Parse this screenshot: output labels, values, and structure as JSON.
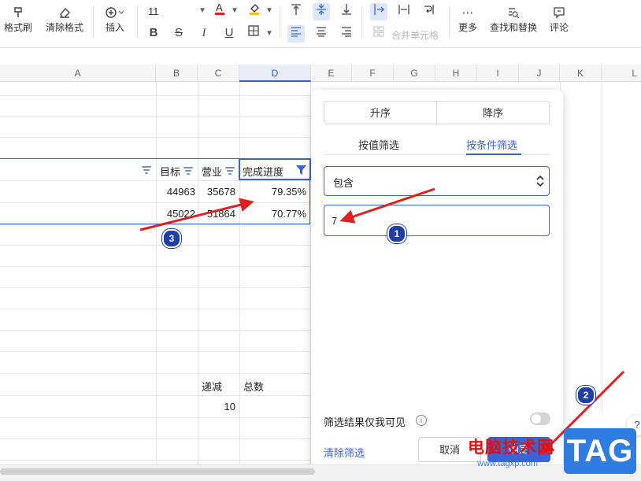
{
  "toolbar": {
    "format_painter": "格式刷",
    "clear_format": "清除格式",
    "insert": "插入",
    "font_size": "11",
    "merge_cells": "合并单元格",
    "more": "更多",
    "find_replace": "查找和替换",
    "comment": "评论"
  },
  "columns": [
    "A",
    "B",
    "C",
    "D",
    "E",
    "F",
    "G",
    "H",
    "I",
    "J",
    "K",
    "L"
  ],
  "table": {
    "headers": [
      "目标",
      "营业",
      "完成进度"
    ],
    "rows": [
      [
        "44963",
        "35678",
        "79.35%"
      ],
      [
        "45022",
        "51864",
        "70.77%"
      ]
    ],
    "lower_headers": [
      "递减",
      "总数"
    ],
    "lower_value": "10"
  },
  "filter_panel": {
    "sort_asc": "升序",
    "sort_desc": "降序",
    "tab_value": "按值筛选",
    "tab_condition": "按条件筛选",
    "condition": "包含",
    "condition_value": "7",
    "visible_only_label": "筛选结果仅我可见",
    "clear_filter": "清除筛选",
    "cancel": "取消",
    "confirm": "确定"
  },
  "annotations": [
    "1",
    "2",
    "3"
  ],
  "watermark": {
    "site_text": "电脑技术网",
    "logo_text": "TAG",
    "url": "www.tagxp.com"
  },
  "colors": {
    "accent": "#3a63d4",
    "arrow": "#e02020",
    "badge": "#1f3ea8"
  }
}
